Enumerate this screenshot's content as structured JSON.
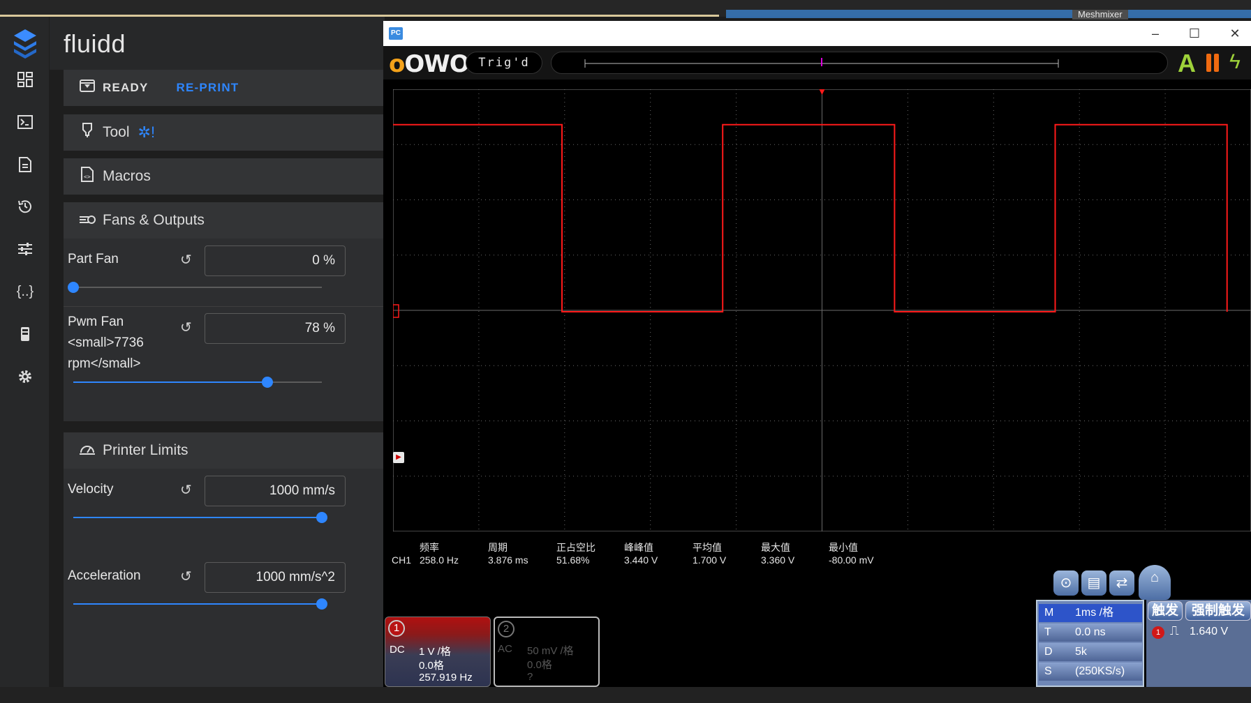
{
  "taskbar": {
    "meshmixer_label": "Meshmixer"
  },
  "fluidd": {
    "app_title": "fluidd",
    "status": {
      "state": "READY",
      "reprint": "RE-PRINT"
    },
    "cards": {
      "tool": "Tool",
      "macros": "Macros",
      "fans_outputs": "Fans & Outputs",
      "printer_limits": "Printer Limits"
    },
    "fans": [
      {
        "label": "Part Fan",
        "value": "0 %",
        "level_percent": 0
      },
      {
        "label": "Pwm Fan",
        "label_line2": "<small>7736",
        "label_line3": "rpm</small>",
        "value": "78 %",
        "level_percent": 78
      }
    ],
    "limits": [
      {
        "label": "Velocity",
        "value": "1000 mm/s",
        "level_percent": 100
      },
      {
        "label": "Acceleration",
        "value": "1000 mm/s^2",
        "level_percent": 100
      }
    ]
  },
  "scope": {
    "window_icon": "PC",
    "brand": "OWON",
    "trigger_status": "Trig'd",
    "measurements": {
      "channel": "CH1",
      "items": [
        {
          "label": "频率",
          "value": "258.0 Hz"
        },
        {
          "label": "周期",
          "value": "3.876 ms"
        },
        {
          "label": "正占空比",
          "value": "51.68%"
        },
        {
          "label": "峰峰值",
          "value": "3.440 V"
        },
        {
          "label": "平均值",
          "value": "1.700 V"
        },
        {
          "label": "最大值",
          "value": "3.360 V"
        },
        {
          "label": "最小值",
          "value": "-80.00 mV"
        }
      ]
    },
    "ch1": {
      "number": "1",
      "coupling": "DC",
      "scale": "1 V /格",
      "offset": "0.0格",
      "freq": "257.919 Hz"
    },
    "ch2": {
      "number": "2",
      "coupling": "AC",
      "scale": "50 mV /格",
      "offset": "0.0格",
      "freq": "?"
    },
    "timebase": [
      {
        "key": "M",
        "value": "1ms /格"
      },
      {
        "key": "T",
        "value": "0.0 ns"
      },
      {
        "key": "D",
        "value": "5k"
      },
      {
        "key": "S",
        "value": "(250KS/s)"
      }
    ],
    "trigger": {
      "btn_trigger": "触发",
      "btn_force": "强制触发",
      "level": "1.640 V"
    },
    "colors": {
      "trace": "#ff1a1a",
      "grid": "#6b6b6b",
      "accent_blue": "#2e86ff"
    }
  }
}
